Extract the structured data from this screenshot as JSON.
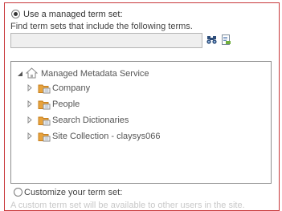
{
  "managed_option": {
    "label": "Use a managed term set:",
    "selected": true
  },
  "search": {
    "instruction": "Find term sets that include the following terms.",
    "value": "",
    "placeholder": ""
  },
  "toolbar": {
    "find_icon": "binoculars-icon",
    "browse_icon": "term-browse-icon"
  },
  "tree": {
    "root": {
      "label": "Managed Metadata Service",
      "icon": "home-icon",
      "expanded": true
    },
    "groups": [
      {
        "label": "Company",
        "icon": "term-group-icon"
      },
      {
        "label": "People",
        "icon": "term-group-icon"
      },
      {
        "label": "Search Dictionaries",
        "icon": "term-group-icon"
      },
      {
        "label": "Site Collection - claysys066",
        "icon": "term-group-icon"
      }
    ]
  },
  "custom_option": {
    "label": "Customize your term set:",
    "selected": false,
    "description": "A custom term set will be available to other users in the site."
  },
  "colors": {
    "frame": "#c8373a",
    "folder": "#e8a33d",
    "folder_dark": "#c67f1e"
  }
}
